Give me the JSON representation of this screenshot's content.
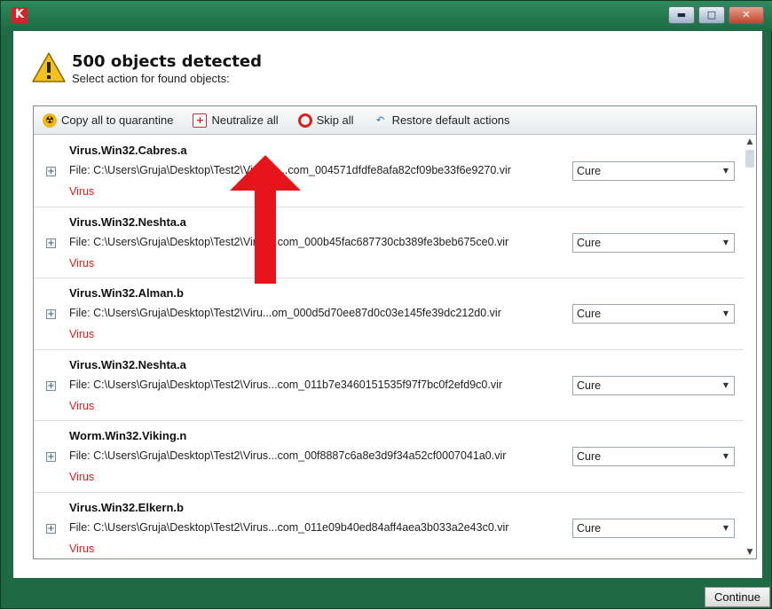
{
  "window": {
    "app_logo": "K",
    "buttons": {
      "minimize": "▬",
      "maximize": "□",
      "close": "✕"
    }
  },
  "header": {
    "title": "500 objects detected",
    "subtitle": "Select action for found objects:"
  },
  "toolbar": {
    "copy_quarantine": "Copy all to quarantine",
    "neutralize_all": "Neutralize all",
    "skip_all": "Skip all",
    "restore_defaults": "Restore default actions"
  },
  "objects": [
    {
      "name": "Virus.Win32.Cabres.a",
      "file": "File: C:\\Users\\Gruja\\Desktop\\Test2\\VirusS....com_004571dfdfe8afa82cf09be33f6e9270.vir",
      "type": "Virus",
      "action": "Cure"
    },
    {
      "name": "Virus.Win32.Neshta.a",
      "file": "File: C:\\Users\\Gruja\\Desktop\\Test2\\Virus...com_000b45fac687730cb389fe3beb675ce0.vir",
      "type": "Virus",
      "action": "Cure"
    },
    {
      "name": "Virus.Win32.Alman.b",
      "file": "File: C:\\Users\\Gruja\\Desktop\\Test2\\Viru...om_000d5d70ee87d0c03e145fe39dc212d0.vir",
      "type": "Virus",
      "action": "Cure"
    },
    {
      "name": "Virus.Win32.Neshta.a",
      "file": "File: C:\\Users\\Gruja\\Desktop\\Test2\\Virus...com_011b7e3460151535f97f7bc0f2efd9c0.vir",
      "type": "Virus",
      "action": "Cure"
    },
    {
      "name": "Worm.Win32.Viking.n",
      "file": "File: C:\\Users\\Gruja\\Desktop\\Test2\\Virus...com_00f8887c6a8e3d9f34a52cf0007041a0.vir",
      "type": "Virus",
      "action": "Cure"
    },
    {
      "name": "Virus.Win32.Elkern.b",
      "file": "File: C:\\Users\\Gruja\\Desktop\\Test2\\Virus...com_011e09b40ed84aff4aea3b033a2e43c0.vir",
      "type": "Virus",
      "action": "Cure"
    }
  ],
  "footer": {
    "continue_label": "Continue"
  },
  "colors": {
    "frame": "#1f6a45",
    "virus_text": "#e0191b",
    "annotation_arrow": "#e8141c"
  }
}
